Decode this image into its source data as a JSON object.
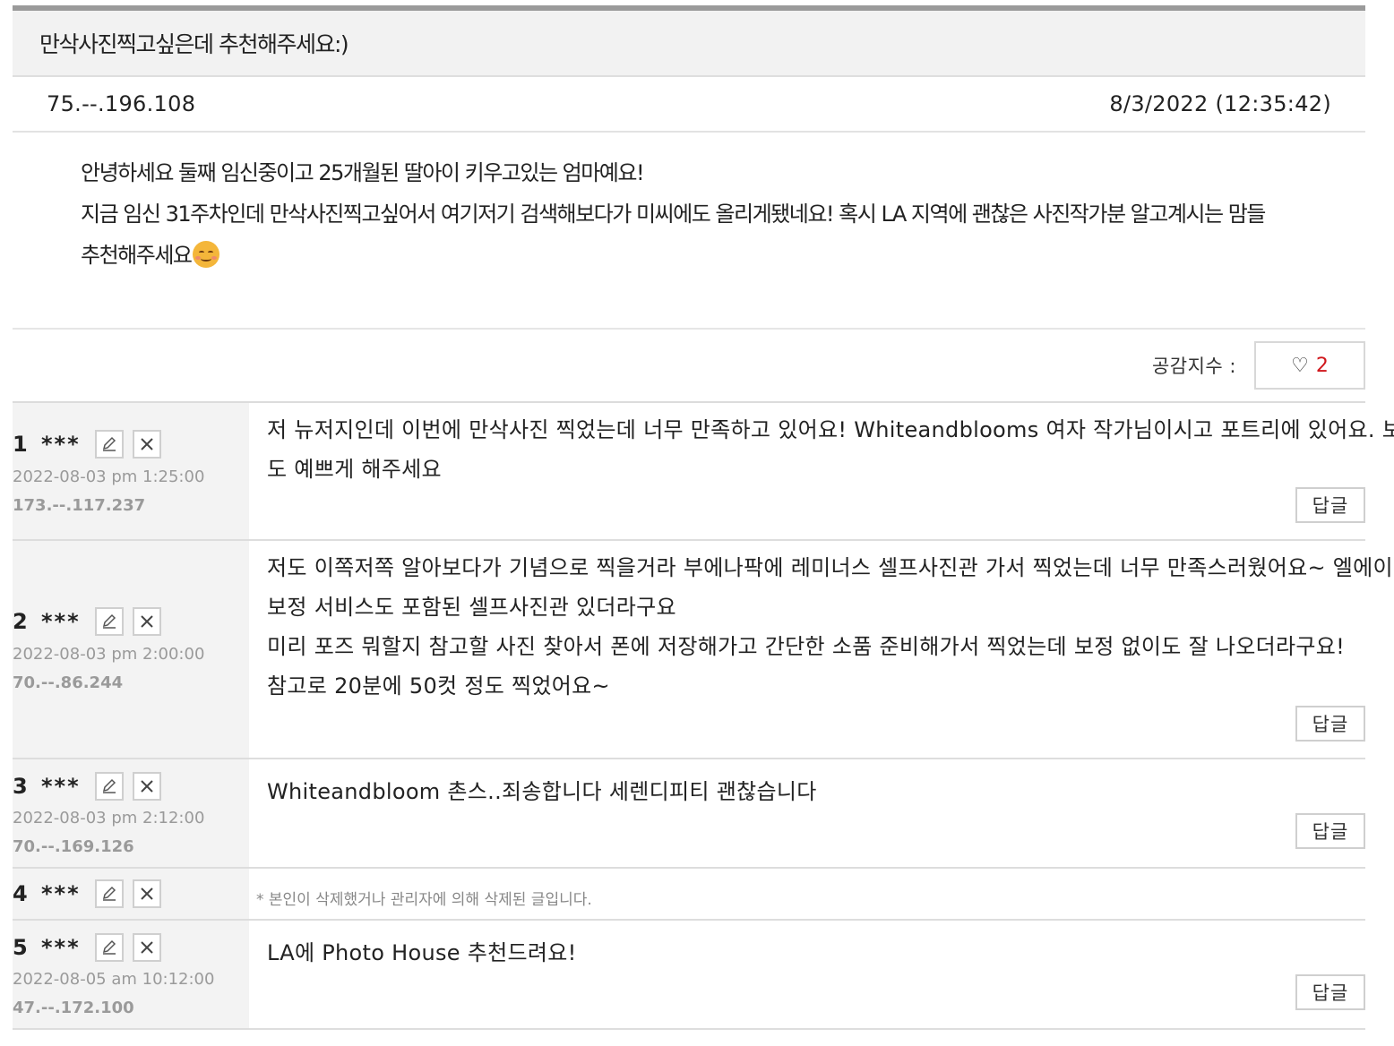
{
  "post": {
    "title": "만삭사진찍고싶은데 추천해주세요:)",
    "author_ip": "75.--.196.108",
    "date": "8/3/2022 (12:35:42)",
    "body_lines": [
      "안녕하세요 둘째 임신중이고 25개월된 딸아이 키우고있는 엄마예요!",
      "지금 임신 31주차인데 만삭사진찍고싶어서 여기저기 검색해보다가 미씨에도 올리게됐네요! 혹시 LA 지역에 괜찮은 사진작가분 알고계시는 맘들",
      "추천해주세요"
    ],
    "emoji": "smiling-face-icon"
  },
  "like": {
    "label": "공감지수 :",
    "heart": "♡",
    "count": "2"
  },
  "reply_label": "답글",
  "comments": [
    {
      "num": "1",
      "user": "***",
      "date": "2022-08-03 pm 1:25:00",
      "ip": "173.--.117.237",
      "lines": [
        "저 뉴저지인데 이번에 만삭사진 찍었는데 너무 만족하고 있어요! Whiteandblooms 여자 작가님이시고 포트리에 있어요. 보정",
        "도 예쁘게 해주세요"
      ]
    },
    {
      "num": "2",
      "user": "***",
      "date": "2022-08-03 pm 2:00:00",
      "ip": "70.--.86.244",
      "lines": [
        "저도 이쪽저쪽 알아보다가 기념으로 찍을거라 부에나팍에 레미너스 셀프사진관 가서 찍었는데 너무 만족스러웠어요~ 엘에이에는",
        "보정 서비스도 포함된 셀프사진관 있더라구요",
        "미리 포즈 뭐할지 참고할 사진 찾아서 폰에 저장해가고 간단한 소품 준비해가서 찍었는데 보정 없이도 잘 나오더라구요!",
        "참고로 20분에 50컷 정도 찍었어요~"
      ]
    },
    {
      "num": "3",
      "user": "***",
      "date": "2022-08-03 pm 2:12:00",
      "ip": "70.--.169.126",
      "lines": [
        "Whiteandbloom 촌스..죄송합니다 세렌디피티 괜찮습니다"
      ]
    },
    {
      "num": "4",
      "user": "***",
      "deleted": "* 본인이 삭제했거나 관리자에 의해 삭제된 글입니다."
    },
    {
      "num": "5",
      "user": "***",
      "date": "2022-08-05 am 10:12:00",
      "ip": "47.--.172.100",
      "lines": [
        "LA에 Photo House 추천드려요!"
      ]
    }
  ]
}
